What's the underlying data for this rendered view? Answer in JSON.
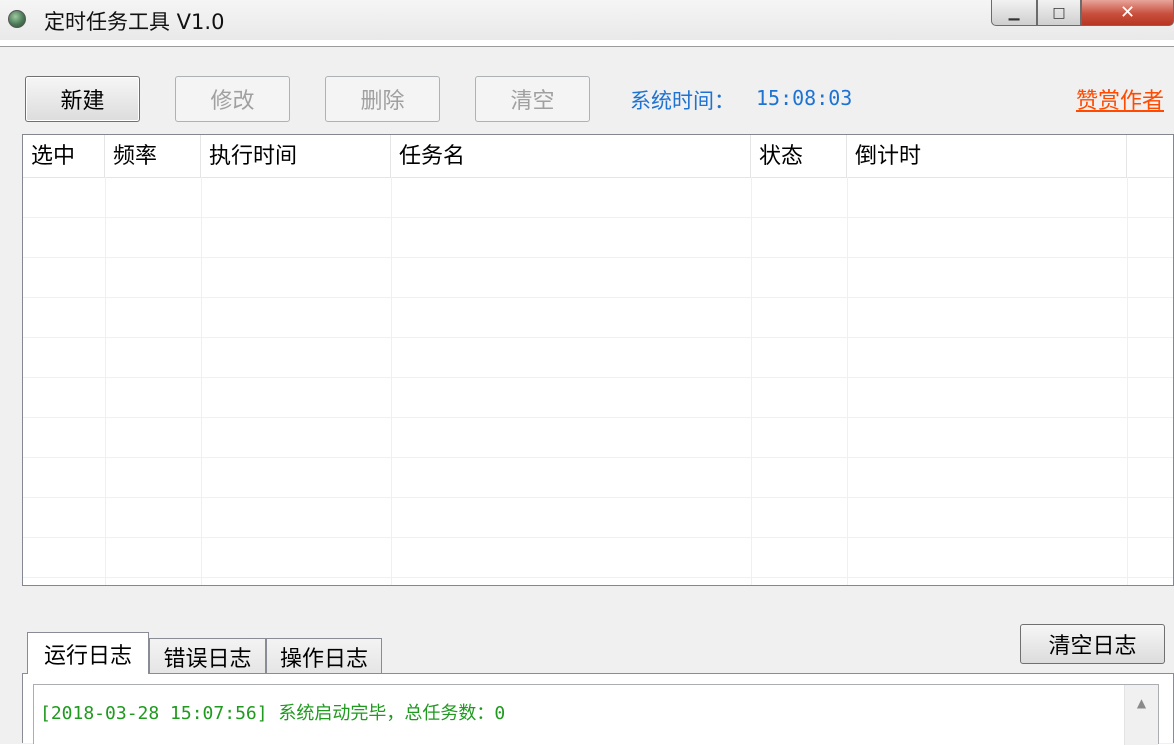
{
  "window": {
    "title": "定时任务工具 V1.0",
    "controls": {
      "minimize": "▁",
      "maximize": "□",
      "close": "✕"
    }
  },
  "toolbar": {
    "new_label": "新建",
    "edit_label": "修改",
    "delete_label": "删除",
    "clear_label": "清空",
    "system_time_label": "系统时间：",
    "system_time_value": "15:08:03",
    "reward_label": "赞赏作者"
  },
  "task_table": {
    "columns": [
      "选中",
      "频率",
      "执行时间",
      "任务名",
      "状态",
      "倒计时"
    ],
    "rows": []
  },
  "log": {
    "tabs": [
      "运行日志",
      "错误日志",
      "操作日志"
    ],
    "active_tab": "运行日志",
    "clear_button": "清空日志",
    "entries": [
      "[2018-03-28 15:07:56] 系统启动完毕，总任务数：0"
    ]
  },
  "colors": {
    "time_text": "#1e73d2",
    "reward_link": "#ff4a00",
    "log_text": "#1f9a1f"
  }
}
